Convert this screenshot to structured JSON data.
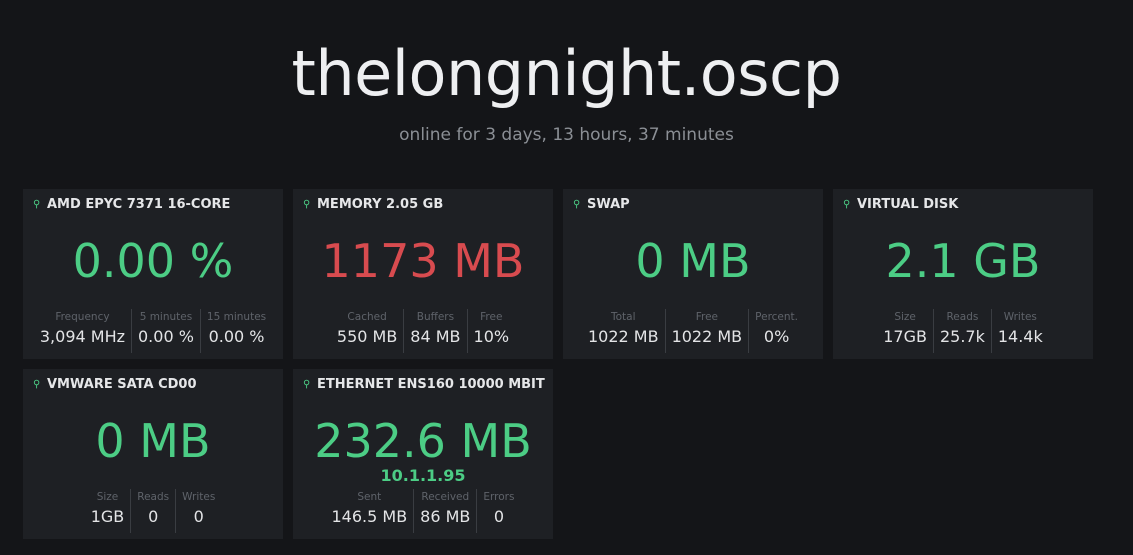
{
  "header": {
    "hostname": "thelongnight.oscp",
    "uptime": "online for 3 days, 13 hours, 37 minutes"
  },
  "colors": {
    "ok": "#4ccd85",
    "alert": "#d84b4f",
    "background": "#141518",
    "card": "#1e2024"
  },
  "cards": [
    {
      "title": "AMD EPYC 7371 16-CORE",
      "icon": "pin-icon",
      "value": "0.00 %",
      "status": "ok",
      "stats": [
        {
          "label": "Frequency",
          "value": "3,094 MHz"
        },
        {
          "label": "5 minutes",
          "value": "0.00 %"
        },
        {
          "label": "15 minutes",
          "value": "0.00 %"
        }
      ]
    },
    {
      "title": "MEMORY 2.05 GB",
      "icon": "pin-icon",
      "value": "1173 MB",
      "status": "alert",
      "stats": [
        {
          "label": "Cached",
          "value": "550 MB"
        },
        {
          "label": "Buffers",
          "value": "84 MB"
        },
        {
          "label": "Free",
          "value": "10%"
        }
      ]
    },
    {
      "title": "SWAP",
      "icon": "pin-icon",
      "value": "0 MB",
      "status": "ok",
      "stats": [
        {
          "label": "Total",
          "value": "1022 MB"
        },
        {
          "label": "Free",
          "value": "1022 MB"
        },
        {
          "label": "Percent.",
          "value": "0%"
        }
      ]
    },
    {
      "title": "VIRTUAL DISK",
      "icon": "pin-icon",
      "value": "2.1 GB",
      "status": "ok",
      "stats": [
        {
          "label": "Size",
          "value": "17GB"
        },
        {
          "label": "Reads",
          "value": "25.7k"
        },
        {
          "label": "Writes",
          "value": "14.4k"
        }
      ]
    },
    {
      "title": "VMWARE SATA CD00",
      "icon": "pin-icon",
      "value": "0 MB",
      "status": "ok",
      "stats": [
        {
          "label": "Size",
          "value": "1GB"
        },
        {
          "label": "Reads",
          "value": "0"
        },
        {
          "label": "Writes",
          "value": "0"
        }
      ]
    },
    {
      "title": "ETHERNET ENS160 10000 MBIT",
      "icon": "pin-icon",
      "value": "232.6 MB",
      "sub": "10.1.1.95",
      "status": "ok",
      "stats": [
        {
          "label": "Sent",
          "value": "146.5 MB"
        },
        {
          "label": "Received",
          "value": "86 MB"
        },
        {
          "label": "Errors",
          "value": "0"
        }
      ]
    }
  ]
}
